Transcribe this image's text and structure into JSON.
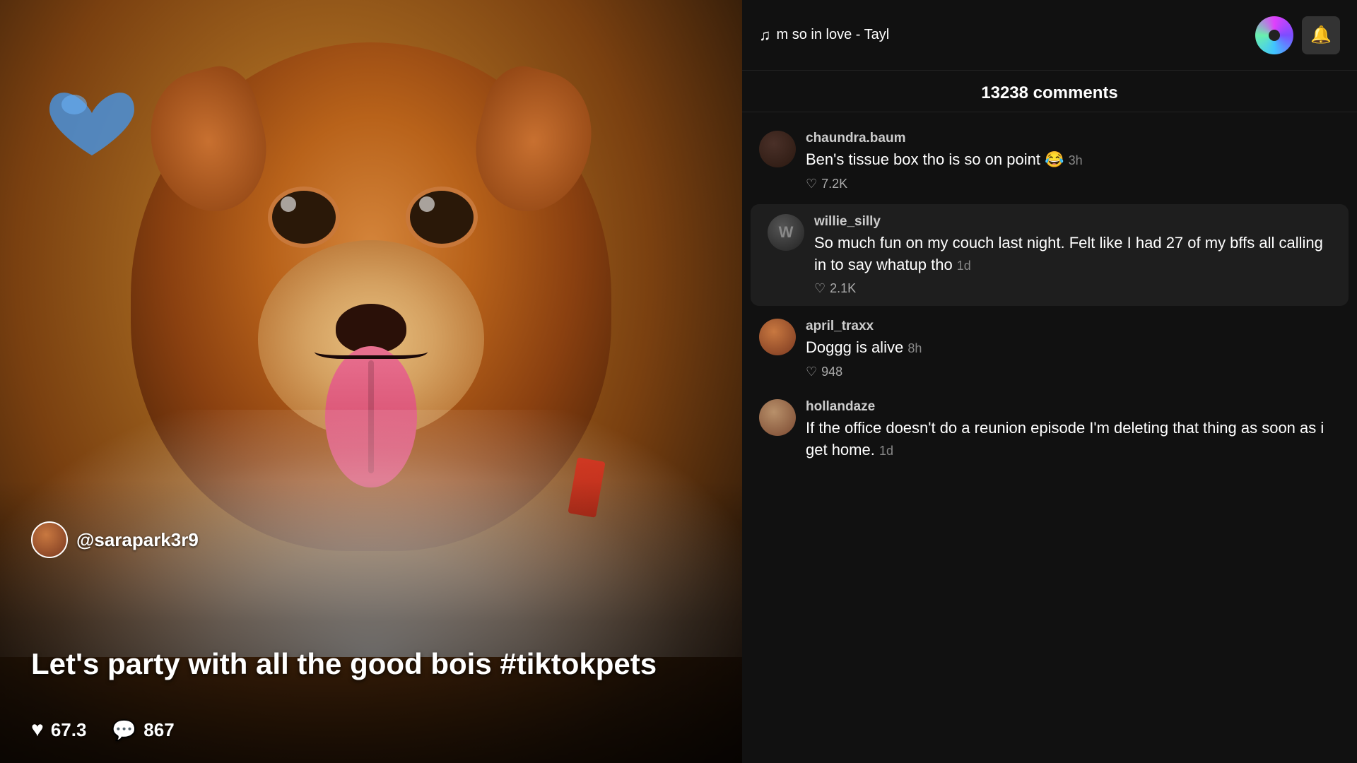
{
  "video": {
    "username": "@sarapark3r9",
    "caption": "Let's party with all the good bois #tiktokpets",
    "likes": "67.3",
    "comments_count_short": "867"
  },
  "music": {
    "text": "m so in love - Tayl",
    "note": "♪"
  },
  "comments": {
    "total": "13238 comments",
    "list": [
      {
        "id": "chaundra",
        "username": "chaundra.baum",
        "text": "Ben's tissue box tho is so on point 😂",
        "time": "3h",
        "likes": "7.2K",
        "highlighted": false,
        "avatar_class": "avatar-chaundra"
      },
      {
        "id": "willie",
        "username": "willie_silly",
        "text": "So much fun on my couch last night. Felt like I had 27 of my bffs all calling in to say whatup tho",
        "time": "1d",
        "likes": "2.1K",
        "highlighted": true,
        "avatar_class": "avatar-willie"
      },
      {
        "id": "april",
        "username": "april_traxx",
        "text": "Doggg is alive",
        "time": "8h",
        "likes": "948",
        "highlighted": false,
        "avatar_class": "avatar-april"
      },
      {
        "id": "holland",
        "username": "hollandaze",
        "text": "If the office doesn't do a reunion episode I'm deleting that thing as soon as i get home.",
        "time": "1d",
        "likes": "",
        "highlighted": false,
        "avatar_class": "avatar-holland"
      }
    ]
  },
  "icons": {
    "heart": "♡",
    "heart_filled": "♥",
    "comment": "💬",
    "bell": "🔔",
    "music_note": "♫"
  }
}
